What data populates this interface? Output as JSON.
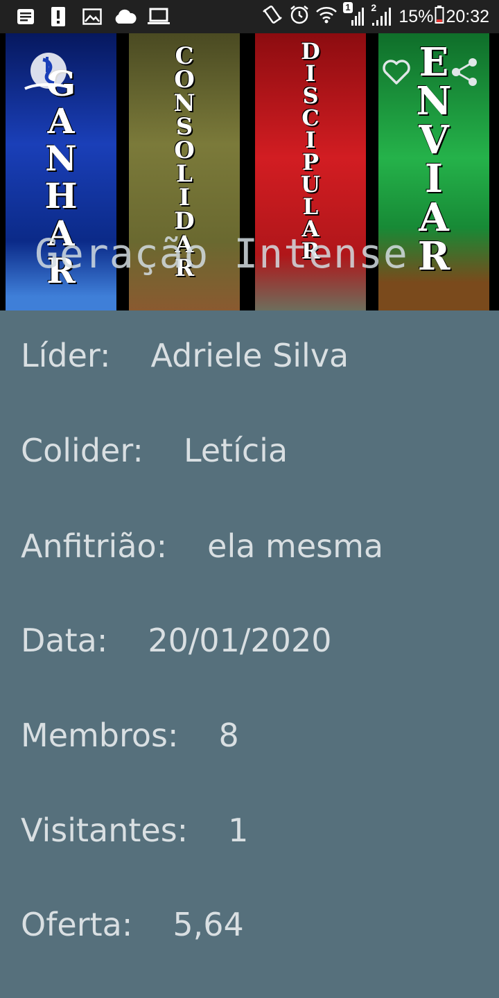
{
  "status_bar": {
    "battery": "15%",
    "time": "20:32",
    "sim1_badge": "1",
    "sim2_badge": "2",
    "battery_color": "#e53935"
  },
  "header": {
    "title": "Geração Intense",
    "banners": [
      {
        "word": "GANHAR",
        "color": "#0c2a8a"
      },
      {
        "word": "CONSOLIDAR",
        "color": "#6b6a2c"
      },
      {
        "word": "DISCIPULAR",
        "color": "#c4171d"
      },
      {
        "word": "ENVIAR",
        "color": "#1d9a3a"
      }
    ],
    "actions": {
      "favorite_icon": "heart-outline-icon",
      "share_icon": "share-icon"
    }
  },
  "details": {
    "lider": {
      "label": "Líder:",
      "value": "Adriele Silva"
    },
    "colider": {
      "label": "Colider:",
      "value": "Letícia"
    },
    "anfitriao": {
      "label": "Anfitrião:",
      "value": "ela mesma"
    },
    "data": {
      "label": "Data:",
      "value": "20/01/2020"
    },
    "membros": {
      "label": "Membros:",
      "value": "8"
    },
    "visitantes": {
      "label": "Visitantes:",
      "value": "1"
    },
    "oferta": {
      "label": "Oferta:",
      "value": "5,64"
    }
  },
  "colors": {
    "background": "#56707c",
    "text": "#d9dfe2",
    "status_bar": "#212121"
  }
}
